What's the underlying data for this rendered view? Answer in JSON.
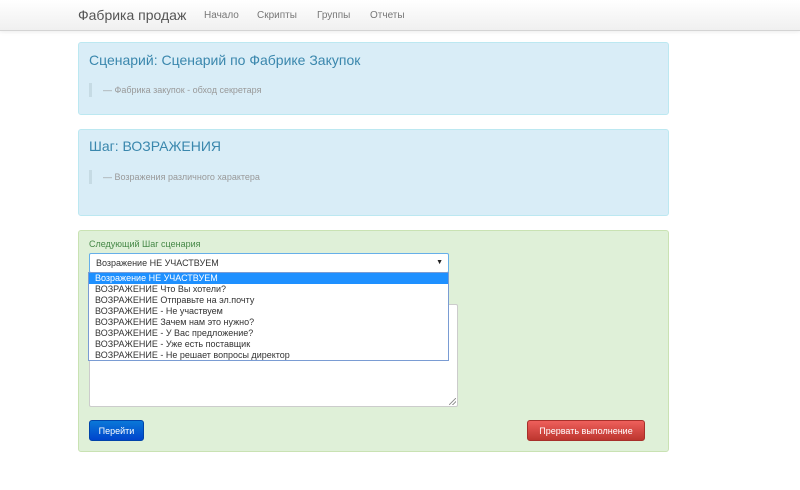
{
  "navbar": {
    "brand": "Фабрика продаж",
    "links": [
      "Начало",
      "Скрипты",
      "Группы",
      "Отчеты"
    ]
  },
  "scenario": {
    "title": "Сценарий: Сценарий по Фабрике Закупок",
    "subtitle": "— Фабрика закупок - обход секретаря"
  },
  "step": {
    "title": "Шаг: ВОЗРАЖЕНИЯ",
    "subtitle": "— Возражения различного характера"
  },
  "form": {
    "next_step_label": "Следующий Шаг сценария",
    "select_value": "Возражение НЕ УЧАСТВУЕМ",
    "options": [
      "Возражение НЕ УЧАСТВУЕМ",
      "ВОЗРАЖЕНИЕ Что Вы хотели?",
      "ВОЗРАЖЕНИЕ Отправьте на эл.почту",
      "ВОЗРАЖЕНИЕ - Не участвуем",
      "ВОЗРАЖЕНИЕ Зачем нам это нужно?",
      "ВОЗРАЖЕНИЕ - У Вас предложение?",
      "ВОЗРАЖЕНИЕ - Уже есть поставщик",
      "ВОЗРАЖЕНИЕ - Не решает вопросы директор"
    ],
    "selected_index": 0,
    "go_button": "Перейти",
    "abort_button": "Прервать выполнение"
  },
  "colors": {
    "info_panel": "#d9edf7",
    "success_panel": "#dff0d8",
    "primary": "#0044cc",
    "danger": "#bd362f",
    "selection": "#1e90ff"
  }
}
